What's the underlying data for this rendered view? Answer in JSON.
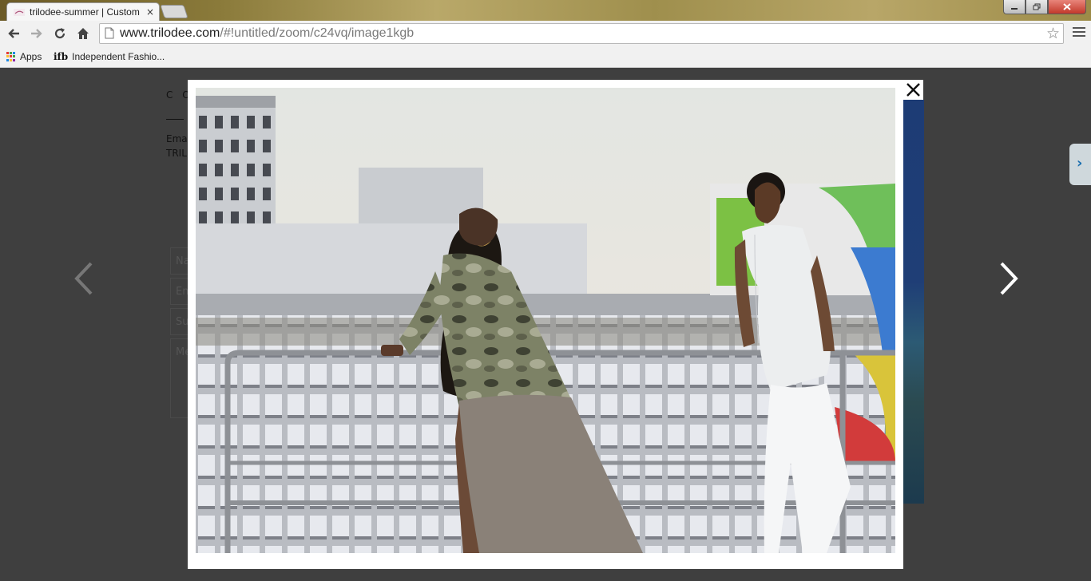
{
  "browser": {
    "tab_title": "trilodee-summer | Custom",
    "tab_close": "×",
    "url_host": "www.trilodee.com",
    "url_path": "/#!untitled/zoom/c24vq/image1kgb",
    "bookmarks": [
      {
        "label": "Apps",
        "icon": "apps-grid-icon"
      },
      {
        "label": "Independent Fashio...",
        "icon": "ifb-icon",
        "icon_text": "ifb"
      }
    ],
    "apps_colors": [
      "#e53935",
      "#43a047",
      "#1e88e5",
      "#fbc02d",
      "#e53935",
      "#43a047",
      "#1e88e5",
      "#fbc02d",
      "#8e24aa"
    ]
  },
  "page_background": {
    "heading": "C O",
    "line1": "Ema",
    "line2": "TRIL",
    "fields": [
      "Na",
      "Em",
      "Su",
      "Me"
    ]
  },
  "lightbox": {
    "photo_alt": "Two people on a rooftop leaning on a railing in front of city buildings",
    "prev_icon": "chevron-left-icon",
    "next_icon": "chevron-right-icon",
    "close_icon": "close-icon"
  }
}
